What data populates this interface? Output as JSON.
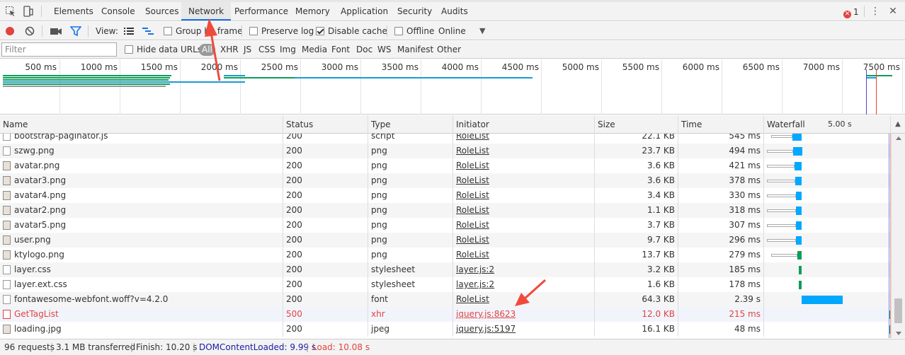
{
  "tabs": [
    "Elements",
    "Console",
    "Sources",
    "Network",
    "Performance",
    "Memory",
    "Application",
    "Security",
    "Audits"
  ],
  "active_tab": "Network",
  "error_count": "1",
  "toolbar": {
    "view_label": "View:",
    "group_by_frame": "Group by frame",
    "preserve_log": "Preserve log",
    "disable_cache": "Disable cache",
    "offline": "Offline",
    "throttle": "Online"
  },
  "filter": {
    "placeholder": "Filter",
    "hide_data_urls": "Hide data URLs",
    "types": [
      "All",
      "XHR",
      "JS",
      "CSS",
      "Img",
      "Media",
      "Font",
      "Doc",
      "WS",
      "Manifest",
      "Other"
    ]
  },
  "overview": {
    "ticks": [
      "500 ms",
      "1000 ms",
      "1500 ms",
      "2000 ms",
      "2500 ms",
      "3000 ms",
      "3500 ms",
      "4000 ms",
      "4500 ms",
      "5000 ms",
      "5500 ms",
      "6000 ms",
      "6500 ms",
      "7000 ms",
      "7500 ms"
    ]
  },
  "columns": {
    "name": "Name",
    "status": "Status",
    "type": "Type",
    "initiator": "Initiator",
    "size": "Size",
    "time": "Time",
    "waterfall": "Waterfall",
    "waterfall_scale": "5.00 s"
  },
  "requests": [
    {
      "name": "bootstrap-paginator.js",
      "status": "200",
      "type": "script",
      "initiator": "RoleList",
      "size": "22.1 KB",
      "time": "545 ms",
      "icon": "file-icon"
    },
    {
      "name": "szwg.png",
      "status": "200",
      "type": "png",
      "initiator": "RoleList",
      "size": "23.7 KB",
      "time": "494 ms",
      "icon": "file-icon"
    },
    {
      "name": "avatar.png",
      "status": "200",
      "type": "png",
      "initiator": "RoleList",
      "size": "3.6 KB",
      "time": "421 ms",
      "icon": "avatar-icon"
    },
    {
      "name": "avatar3.png",
      "status": "200",
      "type": "png",
      "initiator": "RoleList",
      "size": "3.6 KB",
      "time": "378 ms",
      "icon": "avatar-icon"
    },
    {
      "name": "avatar4.png",
      "status": "200",
      "type": "png",
      "initiator": "RoleList",
      "size": "3.4 KB",
      "time": "330 ms",
      "icon": "avatar-icon"
    },
    {
      "name": "avatar2.png",
      "status": "200",
      "type": "png",
      "initiator": "RoleList",
      "size": "1.1 KB",
      "time": "318 ms",
      "icon": "avatar-icon"
    },
    {
      "name": "avatar5.png",
      "status": "200",
      "type": "png",
      "initiator": "RoleList",
      "size": "3.7 KB",
      "time": "307 ms",
      "icon": "avatar-icon"
    },
    {
      "name": "user.png",
      "status": "200",
      "type": "png",
      "initiator": "RoleList",
      "size": "9.7 KB",
      "time": "296 ms",
      "icon": "avatar-icon"
    },
    {
      "name": "ktylogo.png",
      "status": "200",
      "type": "png",
      "initiator": "RoleList",
      "size": "13.7 KB",
      "time": "279 ms",
      "icon": "image-icon"
    },
    {
      "name": "layer.css",
      "status": "200",
      "type": "stylesheet",
      "initiator": "layer.js:2",
      "size": "3.2 KB",
      "time": "185 ms",
      "icon": "file-icon"
    },
    {
      "name": "layer.ext.css",
      "status": "200",
      "type": "stylesheet",
      "initiator": "layer.js:2",
      "size": "1.6 KB",
      "time": "178 ms",
      "icon": "file-icon"
    },
    {
      "name": "fontawesome-webfont.woff?v=4.2.0",
      "status": "200",
      "type": "font",
      "initiator": "RoleList",
      "size": "64.3 KB",
      "time": "2.39 s",
      "icon": "file-icon"
    },
    {
      "name": "GetTagList",
      "status": "500",
      "type": "xhr",
      "initiator": "jquery.js:8623",
      "size": "12.0 KB",
      "time": "215 ms",
      "icon": "file-icon",
      "error": true
    },
    {
      "name": "loading.jpg",
      "status": "200",
      "type": "jpeg",
      "initiator": "jquery.js:5197",
      "size": "16.1 KB",
      "time": "48 ms",
      "icon": "image-icon"
    }
  ],
  "statusbar": {
    "requests": "96 requests",
    "transferred": "3.1 MB transferred",
    "finish": "Finish: 10.20 s",
    "domcontentloaded": "DOMContentLoaded: 9.99 s",
    "load": "Load: 10.08 s"
  },
  "colors": {
    "accent": "#1a73e8",
    "record": "#e0443e",
    "dcl": "#1a1aa6",
    "load": "#e0443e",
    "wf_receive": "#00a8ff",
    "wf_green": "#0e9d58"
  }
}
